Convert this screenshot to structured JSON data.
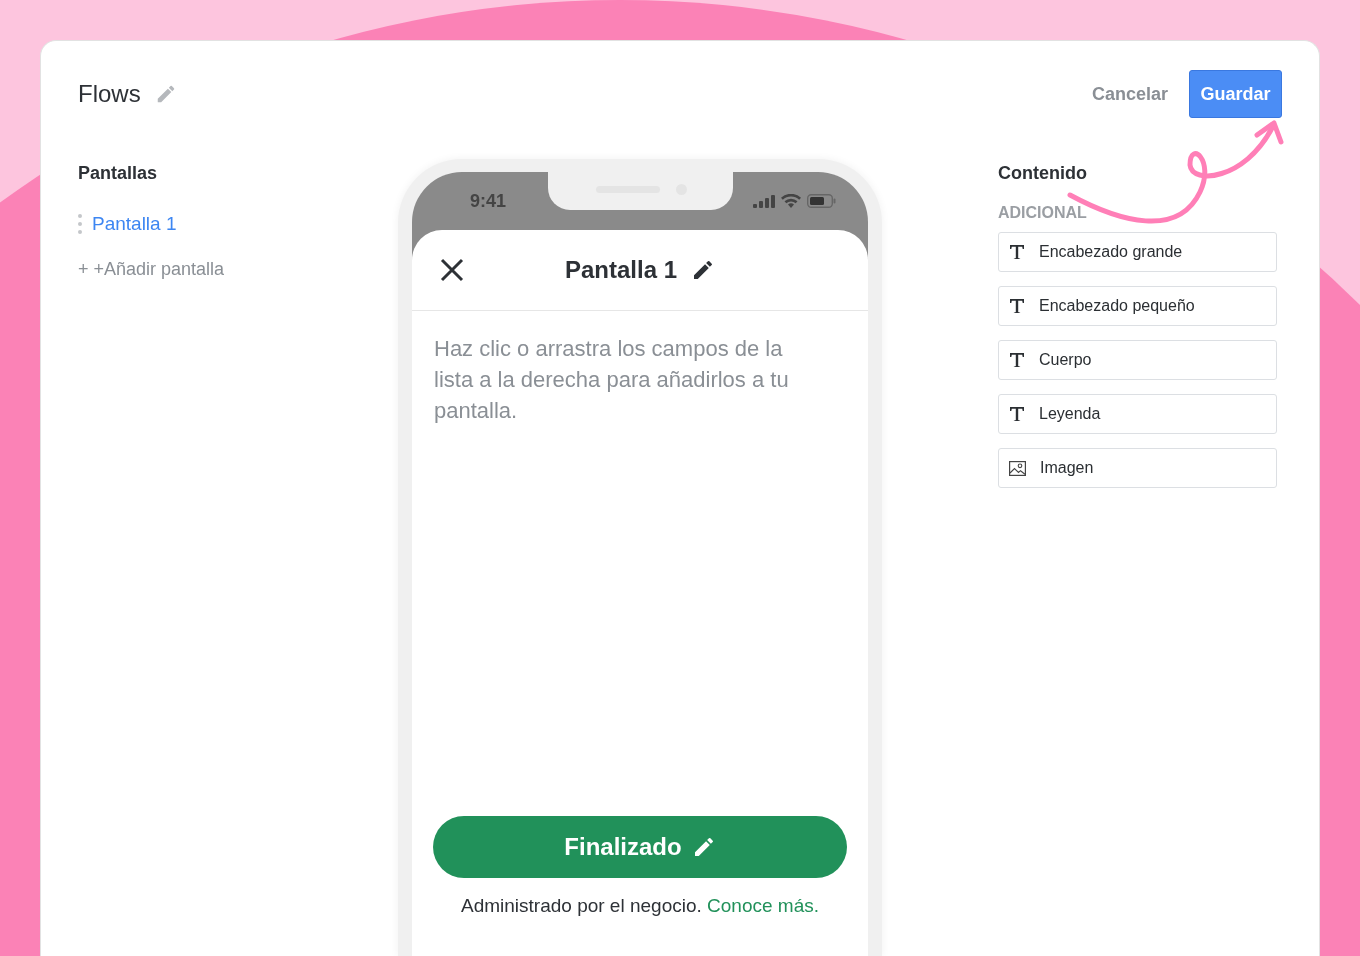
{
  "header": {
    "title": "Flows",
    "cancel": "Cancelar",
    "save": "Guardar"
  },
  "screens": {
    "heading": "Pantallas",
    "items": [
      {
        "label": "Pantalla 1",
        "selected": true
      }
    ],
    "add": "+ +Añadir pantalla"
  },
  "phone": {
    "time": "9:41",
    "screen_title": "Pantalla 1",
    "hint": "Haz clic o arrastra los campos de la lista a la derecha para añadirlos a tu pantalla.",
    "button": "Finalizado",
    "footer": "Administrado por el negocio.",
    "footer_link": "Conoce más."
  },
  "content": {
    "heading": "Contenido",
    "section": "ADICIONAL",
    "fields": [
      {
        "kind": "text",
        "label": "Encabezado grande"
      },
      {
        "kind": "text",
        "label": "Encabezado pequeño"
      },
      {
        "kind": "text",
        "label": "Cuerpo"
      },
      {
        "kind": "text",
        "label": "Leyenda"
      },
      {
        "kind": "image",
        "label": "Imagen"
      }
    ]
  }
}
